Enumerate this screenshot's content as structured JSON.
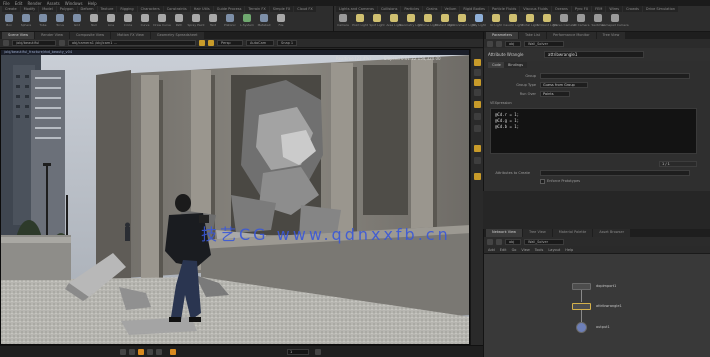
{
  "menubar": [
    "File",
    "Edit",
    "Render",
    "Assets",
    "Windows",
    "Help"
  ],
  "shelf_left": {
    "tabs": [
      "Create",
      "Modify",
      "Model",
      "Polygon",
      "Deform",
      "Texture",
      "Rigging",
      "Characters",
      "Constraints",
      "Hair Utils",
      "Guide Process",
      "Terrain FX",
      "Simple FX",
      "Cloud FX"
    ],
    "tools": [
      {
        "label": "Box",
        "color": "#7d8fa8"
      },
      {
        "label": "Sphere",
        "color": "#7d8fa8"
      },
      {
        "label": "Tube",
        "color": "#7d8fa8"
      },
      {
        "label": "Torus",
        "color": "#7d8fa8"
      },
      {
        "label": "Grid",
        "color": "#7d8fa8"
      },
      {
        "label": "Null",
        "color": "#a8a8a8"
      },
      {
        "label": "Line",
        "color": "#a8a8a8"
      },
      {
        "label": "Circle",
        "color": "#a8a8a8"
      },
      {
        "label": "Curve",
        "color": "#a8a8a8"
      },
      {
        "label": "Draw Curve",
        "color": "#a8a8a8"
      },
      {
        "label": "Path",
        "color": "#a8a8a8"
      },
      {
        "label": "Spray Paint",
        "color": "#a8a8a8"
      },
      {
        "label": "Text",
        "color": "#a8a8a8"
      },
      {
        "label": "Platonic",
        "color": "#7d8fa8"
      },
      {
        "label": "L-System",
        "color": "#6fa86f"
      },
      {
        "label": "Metaball",
        "color": "#7d8fa8"
      },
      {
        "label": "File",
        "color": "#a8a8a8"
      }
    ]
  },
  "shelf_right": {
    "tabs": [
      "Lights and Cameras",
      "Collisions",
      "Particles",
      "Grains",
      "Vellum",
      "Rigid Bodies",
      "Particle Fluids",
      "Viscous Fluids",
      "Oceans",
      "Pyro FX",
      "FEM",
      "Wires",
      "Crowds",
      "Drive Simulation"
    ],
    "tools": [
      {
        "label": "Camera",
        "color": "#9a9a9a"
      },
      {
        "label": "Point Light",
        "color": "#d0c070"
      },
      {
        "label": "Spot Light",
        "color": "#d0c070"
      },
      {
        "label": "Area Light",
        "color": "#d0c070"
      },
      {
        "label": "Geometry Light",
        "color": "#d0c070"
      },
      {
        "label": "Volume Light",
        "color": "#d0c070"
      },
      {
        "label": "Distant Light",
        "color": "#d0c070"
      },
      {
        "label": "Environment Light",
        "color": "#d0c070"
      },
      {
        "label": "Sky Light",
        "color": "#8fb0d8"
      },
      {
        "label": "GI Light",
        "color": "#d0c070"
      },
      {
        "label": "Caustic Light",
        "color": "#d0c070"
      },
      {
        "label": "Portal Light",
        "color": "#d0c070"
      },
      {
        "label": "Ambient Light",
        "color": "#d0c070"
      },
      {
        "label": "Stereo Camera",
        "color": "#9a9a9a"
      },
      {
        "label": "VR Camera",
        "color": "#9a9a9a"
      },
      {
        "label": "Switcher",
        "color": "#9a9a9a"
      },
      {
        "label": "Gamepad Camera",
        "color": "#9a9a9a"
      }
    ]
  },
  "pane_tabs": [
    "Scene View",
    "Render View",
    "Composite View",
    "Motion FX View",
    "Geometry Spreadsheet"
  ],
  "viewer_toolbar": {
    "object_path": "/obj/beautiful",
    "camera_path": "obj/camera1  /obj/cam1 ...",
    "view_label": "Persp",
    "cam_label": "AutoCam",
    "snap_label": "Snap 1"
  },
  "viewport": {
    "header_left": "/obj/beautiful_fracture/rbd_beauty_v04",
    "header_mid": "",
    "mode": "Realtime (23.4%)",
    "stats": "Elapsed 0:01:22   154,324.00",
    "info_lines": [
      "Realtime",
      "Memory: 1.2 GB",
      "FPS: 24"
    ],
    "watermark": "技艺CG www.qdnxxfb.cn"
  },
  "timeline": {
    "frame": "1"
  },
  "right_tabs": [
    "Parameters",
    "Take List",
    "Performance Monitor",
    "Tree View"
  ],
  "param_pathbar": {
    "path": "obj",
    "node": "Wall_Solver"
  },
  "param_header": {
    "node_type": "Attribute Wrangle",
    "node_name": "attribwrangle1"
  },
  "param_tabs": [
    "Code",
    "Bindings"
  ],
  "params": [
    {
      "label": "Group",
      "value": ""
    },
    {
      "label": "Group Type",
      "value": "Guess from Group"
    },
    {
      "label": "Run Over",
      "value": "Points"
    }
  ],
  "vexpression_label": "VEXpression",
  "snippet_lines": [
    "@Cd.r = 1;",
    "@Cd.g = 1;",
    "@Cd.b = 1;"
  ],
  "snippet_footer": "1 / 1",
  "attrib_to_create_label": "Attributes to Create",
  "enforce_label": "Enforce Prototypes",
  "net_tabs": [
    "Network View",
    "Tree View",
    "Material Palette",
    "Asset Browser"
  ],
  "net_pathbar": {
    "path": "obj",
    "node": "Wall_Solver"
  },
  "net_menu": [
    "Add",
    "Edit",
    "Go",
    "View",
    "Tools",
    "Layout",
    "Help"
  ],
  "nodes": [
    {
      "name": "dopimport1",
      "sub": ""
    },
    {
      "name": "attribwrangle1",
      "sub": ""
    },
    {
      "name": "output1",
      "sub": ""
    }
  ]
}
